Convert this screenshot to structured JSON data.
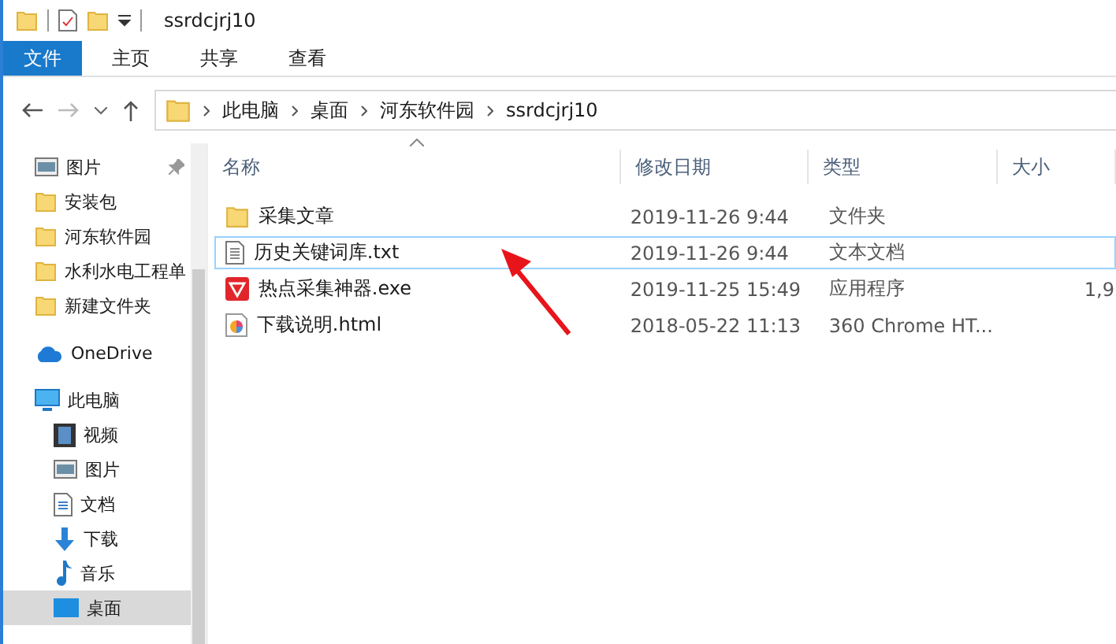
{
  "window": {
    "title": "ssrdcjrj10"
  },
  "ribbon_tabs": [
    {
      "label": "文件",
      "selected": true
    },
    {
      "label": "主页",
      "selected": false
    },
    {
      "label": "共享",
      "selected": false
    },
    {
      "label": "查看",
      "selected": false
    }
  ],
  "breadcrumbs": [
    "此电脑",
    "桌面",
    "河东软件园",
    "ssrdcjrj10"
  ],
  "nav": [
    {
      "label": "图片",
      "kind": "pictures",
      "pinned": true,
      "selected": false
    },
    {
      "label": "安装包",
      "kind": "folder",
      "pinned": false,
      "selected": false
    },
    {
      "label": "河东软件园",
      "kind": "folder",
      "pinned": false,
      "selected": false
    },
    {
      "label": "水利水电工程单",
      "kind": "folder",
      "pinned": false,
      "selected": false
    },
    {
      "label": "新建文件夹",
      "kind": "folder",
      "pinned": false,
      "selected": false
    },
    {
      "label": "OneDrive",
      "kind": "cloud",
      "pinned": false,
      "selected": false
    },
    {
      "label": "此电脑",
      "kind": "pc",
      "pinned": false,
      "selected": false,
      "children": [
        {
          "label": "视频",
          "kind": "video",
          "pinned": false,
          "selected": false
        },
        {
          "label": "图片",
          "kind": "pictures",
          "pinned": false,
          "selected": false
        },
        {
          "label": "文档",
          "kind": "document",
          "pinned": false,
          "selected": false
        },
        {
          "label": "下载",
          "kind": "download",
          "pinned": false,
          "selected": false
        },
        {
          "label": "音乐",
          "kind": "music",
          "pinned": false,
          "selected": false
        },
        {
          "label": "桌面",
          "kind": "desktop",
          "pinned": false,
          "selected": true
        }
      ]
    }
  ],
  "table": {
    "columns": [
      "名称",
      "修改日期",
      "类型",
      "大小"
    ],
    "rows": [
      {
        "kind": "folder",
        "name": "采集文章",
        "date": "2019-11-26 9:44",
        "type": "文件夹",
        "selected": false
      },
      {
        "kind": "text",
        "name": "历史关键词库.txt",
        "date": "2019-11-26 9:44",
        "type": "文本文档",
        "selected": true
      },
      {
        "kind": "app",
        "name": "热点采集神器.exe",
        "date": "2019-11-25 15:49",
        "type": "应用程序",
        "size": "1,9",
        "selected": false
      },
      {
        "kind": "html",
        "name": "下载说明.html",
        "date": "2018-05-22 11:13",
        "type": "360 Chrome HT...",
        "selected": false
      }
    ]
  }
}
